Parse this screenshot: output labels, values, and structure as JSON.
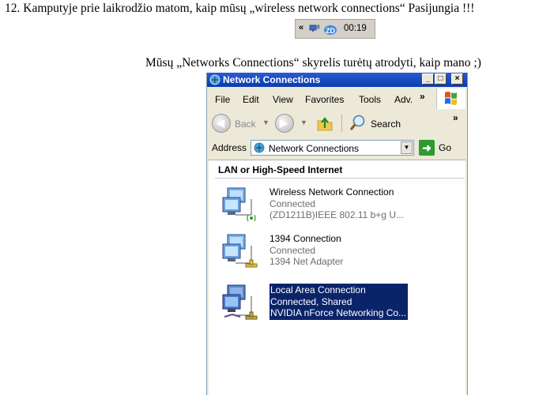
{
  "heading": "12. Kamputyje prie laikrodžio matom, kaip mūsų „wireless network connections“ Pasijungia !!!",
  "note": "Mūsų „Networks Connections“ skyrelis turėtų atrodyti, kaip mano ;)",
  "tray": {
    "chevron": "«",
    "time": "00:19"
  },
  "window": {
    "title": "Network Connections",
    "controls": {
      "minimize": "_",
      "maximize": "□",
      "close": "×"
    },
    "menu": [
      "File",
      "Edit",
      "View",
      "Favorites",
      "Tools",
      "Adv."
    ],
    "menu_more": "»",
    "toolbar": {
      "back": "Back",
      "search": "Search",
      "more": "»"
    },
    "address": {
      "label": "Address",
      "value": "Network Connections",
      "go": "Go"
    },
    "group_title": "LAN or High-Speed Internet",
    "connections": [
      {
        "name": "Wireless Network Connection",
        "status": "Connected",
        "device": "(ZD1211B)IEEE 802.11 b+g U...",
        "icon": "wireless-connection-icon",
        "selected": false
      },
      {
        "name": "1394 Connection",
        "status": "Connected",
        "device": "1394 Net Adapter",
        "icon": "lan-connection-icon",
        "selected": false
      },
      {
        "name": "Local Area Connection",
        "status": "Connected, Shared",
        "device": "NVIDIA nForce Networking Co...",
        "icon": "shared-lan-connection-icon",
        "selected": true
      }
    ]
  },
  "colors": {
    "titlebar": "#0a3cb0",
    "selection": "#0a246a",
    "window_bg": "#ece9d8",
    "go_green": "#2f9a2f"
  }
}
